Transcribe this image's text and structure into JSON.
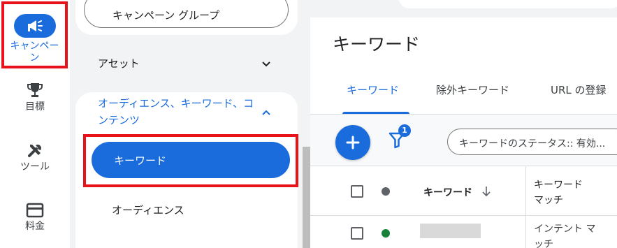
{
  "rail": {
    "items": [
      {
        "label": "キャンペー\nン",
        "icon": "megaphone-icon",
        "active": true
      },
      {
        "label": "目標",
        "icon": "trophy-icon"
      },
      {
        "label": "ツール",
        "icon": "tools-icon"
      },
      {
        "label": "料金",
        "icon": "credit-card-icon"
      }
    ]
  },
  "subnav": {
    "campaign_group_label": "キャンペーン グループ",
    "assets_label": "アセット",
    "section_title": "オーディエンス、キーワード、コンテンツ",
    "items": [
      {
        "label": "キーワード",
        "selected": true
      },
      {
        "label": "オーディエンス"
      }
    ]
  },
  "main": {
    "title": "キーワード",
    "tabs": [
      {
        "label": "キーワード",
        "active": true
      },
      {
        "label": "除外キーワード"
      },
      {
        "label": "URL の登録"
      }
    ],
    "filter_badge": "1",
    "filter_chip": "キーワードのステータス:: 有効...",
    "table": {
      "headers": {
        "keyword": "キーワード",
        "match": "キーワード\nマッチ"
      },
      "rows": [
        {
          "keyword": "",
          "match": "インテント マ\nッチ",
          "status_color": "#188038"
        }
      ]
    }
  },
  "colors": {
    "accent": "#1a6cdc",
    "highlight": "#e8121a",
    "status_gray": "#5f6368",
    "status_green": "#188038"
  }
}
